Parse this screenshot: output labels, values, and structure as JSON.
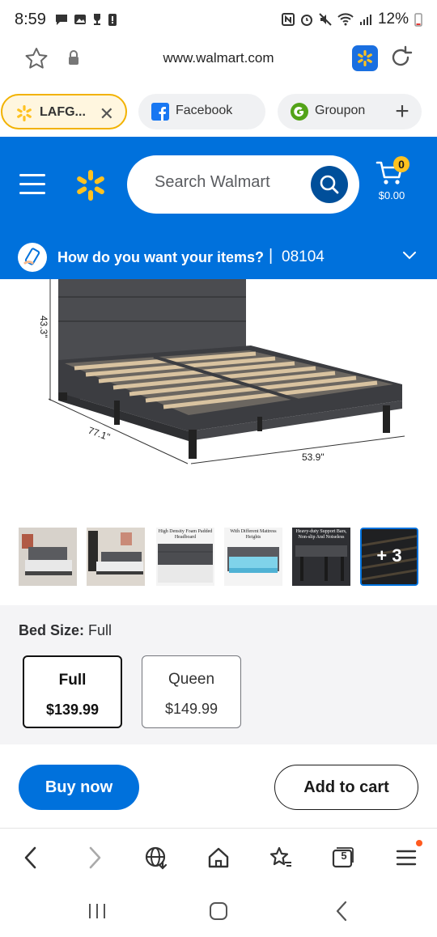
{
  "status_bar": {
    "time": "8:59",
    "battery": "12%"
  },
  "url_bar": {
    "url": "www.walmart.com"
  },
  "tabs": [
    {
      "label": "LAFG...",
      "active": true
    },
    {
      "label": "Facebook",
      "active": false
    },
    {
      "label": "Groupon",
      "active": false
    }
  ],
  "header": {
    "search_placeholder": "Search Walmart",
    "cart_count": "0",
    "cart_total": "$0.00"
  },
  "delivery": {
    "question": "How do you want your items?",
    "separator": "|",
    "zip": "08104"
  },
  "product_image": {
    "dim_height": "43.3\"",
    "dim_length": "77.1\"",
    "dim_width": "53.9\""
  },
  "thumbnails": {
    "captions": [
      "",
      "",
      "High Density Foam Padded Headboard",
      "With Different Mattress Heights",
      "Heavy-duty Support Bars, Non-slip And Noiseless",
      ""
    ],
    "more_label": "+ 3"
  },
  "bed_size": {
    "label": "Bed Size:",
    "selected": "Full",
    "options": [
      {
        "name": "Full",
        "price": "$139.99",
        "selected": true
      },
      {
        "name": "Queen",
        "price": "$149.99",
        "selected": false
      }
    ]
  },
  "actions": {
    "buy_now": "Buy now",
    "add_to_cart": "Add to cart"
  },
  "browser_toolbar": {
    "tabs_count": "5"
  },
  "colors": {
    "walmart_blue": "#0071dc",
    "walmart_dark_blue": "#004f9a",
    "walmart_yellow": "#ffc220"
  }
}
